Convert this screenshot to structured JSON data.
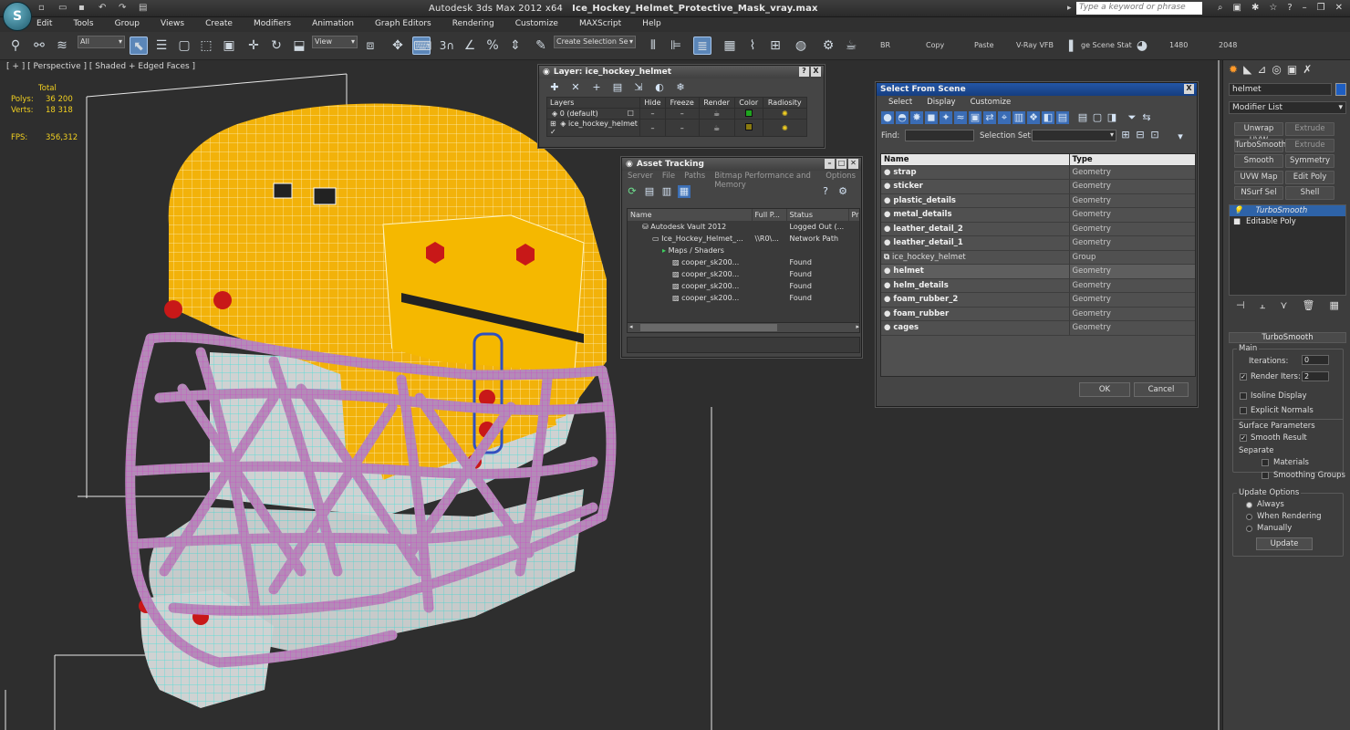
{
  "titlebar": {
    "logo": "S",
    "app": "Autodesk 3ds Max  2012 x64",
    "file": "Ice_Hockey_Helmet_Protective_Mask_vray.max",
    "search_placeholder": "Type a keyword or phrase"
  },
  "menu": [
    "Edit",
    "Tools",
    "Group",
    "Views",
    "Create",
    "Modifiers",
    "Animation",
    "Graph Editors",
    "Rendering",
    "Customize",
    "MAXScript",
    "Help"
  ],
  "toolbar": {
    "filter": "All",
    "ref_coord": "View",
    "selection_set": "Create Selection Se",
    "snaps_label": "3",
    "br": "BR",
    "copy": "Copy",
    "paste": "Paste",
    "vray_vfb": "V-Ray VFB",
    "scene_states": "ge Scene Stat",
    "width": "1480",
    "height": "2048"
  },
  "viewport": {
    "label": "[ + ] [ Perspective ] [ Shaded + Edged Faces ]",
    "stats": {
      "total": "Total",
      "polys_label": "Polys:",
      "polys": "36 200",
      "verts_label": "Verts:",
      "verts": "18 318",
      "fps_label": "FPS:",
      "fps": "356,312"
    }
  },
  "layer_dialog": {
    "title": "Layer: ice_hockey_helmet",
    "help": "?",
    "close": "X",
    "columns": [
      "Layers",
      "Hide",
      "Freeze",
      "Render",
      "Color",
      "Radiosity"
    ],
    "rows": [
      {
        "name": "0 (default)",
        "mark": "☐",
        "color": "#1fa51f"
      },
      {
        "name": "ice_hockey_helmet",
        "mark": "✓",
        "color": "#8a7a10"
      }
    ]
  },
  "asset_tracking": {
    "title": "Asset Tracking",
    "menu": [
      "Server",
      "File",
      "Paths",
      "Bitmap Performance and Memory",
      "Options"
    ],
    "columns": [
      "Name",
      "Full P...",
      "Status",
      "Pr"
    ],
    "rows": [
      {
        "indent": 0,
        "name": "Autodesk Vault 2012",
        "path": "",
        "status": "Logged Out (..."
      },
      {
        "indent": 1,
        "name": "Ice_Hockey_Helmet_...",
        "path": "\\\\R0\\...",
        "status": "Network Path"
      },
      {
        "indent": 2,
        "name": "Maps / Shaders",
        "path": "",
        "status": ""
      },
      {
        "indent": 3,
        "name": "cooper_sk200...",
        "path": "",
        "status": "Found"
      },
      {
        "indent": 3,
        "name": "cooper_sk200...",
        "path": "",
        "status": "Found"
      },
      {
        "indent": 3,
        "name": "cooper_sk200...",
        "path": "",
        "status": "Found"
      },
      {
        "indent": 3,
        "name": "cooper_sk200...",
        "path": "",
        "status": "Found"
      }
    ]
  },
  "select_from_scene": {
    "title": "Select From Scene",
    "close": "X",
    "menu": [
      "Select",
      "Display",
      "Customize"
    ],
    "find_label": "Find:",
    "selection_set_label": "Selection Set:",
    "columns": [
      "Name",
      "Type"
    ],
    "rows": [
      {
        "name": "strap",
        "type": "Geometry"
      },
      {
        "name": "sticker",
        "type": "Geometry"
      },
      {
        "name": "plastic_details",
        "type": "Geometry"
      },
      {
        "name": "metal_details",
        "type": "Geometry"
      },
      {
        "name": "leather_detail_2",
        "type": "Geometry"
      },
      {
        "name": "leather_detail_1",
        "type": "Geometry"
      },
      {
        "name": "ice_hockey_helmet",
        "type": "Group"
      },
      {
        "name": "helmet",
        "type": "Geometry"
      },
      {
        "name": "helm_details",
        "type": "Geometry"
      },
      {
        "name": "foam_rubber_2",
        "type": "Geometry"
      },
      {
        "name": "foam_rubber",
        "type": "Geometry"
      },
      {
        "name": "cages",
        "type": "Geometry"
      }
    ],
    "ok": "OK",
    "cancel": "Cancel"
  },
  "command_panel": {
    "object_name": "helmet",
    "object_color": "#1e5ec2",
    "modifier_list": "Modifier List",
    "buttons": [
      "Unwrap UVW",
      "Extrude",
      "TurboSmooth",
      "Extrude",
      "Smooth",
      "Symmetry",
      "UVW Map",
      "Edit Poly",
      "NSurf Sel",
      "Shell"
    ],
    "stack": [
      "TurboSmooth",
      "Editable Poly"
    ],
    "rollout": {
      "title": "TurboSmooth",
      "main": "Main",
      "iterations_label": "Iterations:",
      "iterations": "0",
      "render_iters_label": "Render Iters:",
      "render_iters": "2",
      "isoline": "Isoline Display",
      "explicit": "Explicit Normals",
      "surface": "Surface Parameters",
      "smooth_result": "Smooth Result",
      "separate": "Separate",
      "materials": "Materials",
      "smoothing_groups": "Smoothing Groups",
      "update_options": "Update Options",
      "always": "Always",
      "when_rendering": "When Rendering",
      "manually": "Manually",
      "update": "Update"
    }
  }
}
